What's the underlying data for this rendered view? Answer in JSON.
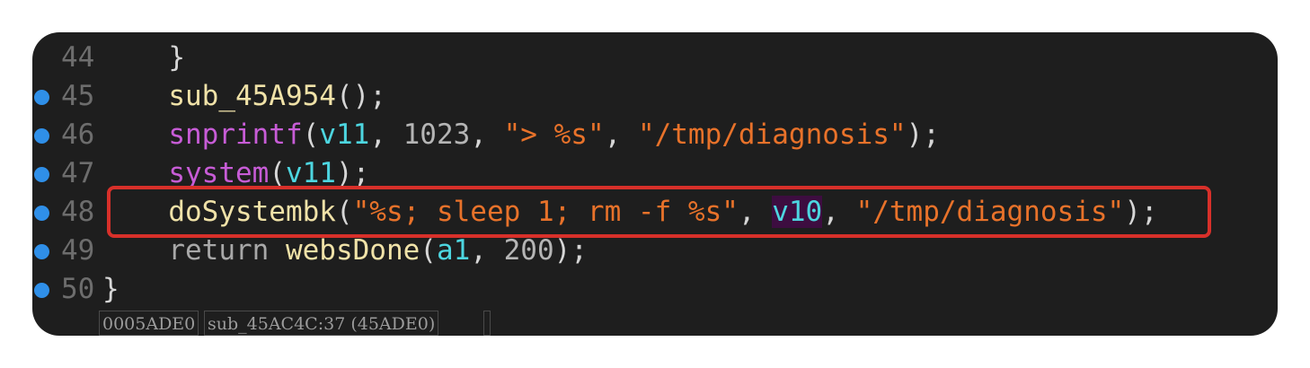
{
  "lines": [
    {
      "num": "44",
      "parts": [
        {
          "t": "  }",
          "c": "plain"
        }
      ],
      "breakpoint": false
    },
    {
      "num": "45",
      "parts": [
        {
          "t": "  ",
          "c": "plain"
        },
        {
          "t": "sub_45A954",
          "c": "fn-yellow"
        },
        {
          "t": "();",
          "c": "plain"
        }
      ],
      "breakpoint": true
    },
    {
      "num": "46",
      "parts": [
        {
          "t": "  ",
          "c": "plain"
        },
        {
          "t": "snprintf",
          "c": "fn-purple"
        },
        {
          "t": "(",
          "c": "plain"
        },
        {
          "t": "v11",
          "c": "var"
        },
        {
          "t": ", ",
          "c": "plain"
        },
        {
          "t": "1023",
          "c": "num"
        },
        {
          "t": ", ",
          "c": "plain"
        },
        {
          "t": "\"> %s\"",
          "c": "str"
        },
        {
          "t": ", ",
          "c": "plain"
        },
        {
          "t": "\"/tmp/diagnosis\"",
          "c": "str"
        },
        {
          "t": ");",
          "c": "plain"
        }
      ],
      "breakpoint": true
    },
    {
      "num": "47",
      "parts": [
        {
          "t": "  ",
          "c": "plain"
        },
        {
          "t": "system",
          "c": "fn-purple"
        },
        {
          "t": "(",
          "c": "plain"
        },
        {
          "t": "v11",
          "c": "var"
        },
        {
          "t": ");",
          "c": "plain"
        }
      ],
      "breakpoint": true
    },
    {
      "num": "48",
      "parts": [
        {
          "t": "  ",
          "c": "plain"
        },
        {
          "t": "doSystembk",
          "c": "fn-yellow"
        },
        {
          "t": "(",
          "c": "plain"
        },
        {
          "t": "\"%s; sleep 1; rm -f %s\"",
          "c": "str"
        },
        {
          "t": ", ",
          "c": "plain"
        },
        {
          "t": "v10",
          "c": "var hl"
        },
        {
          "t": ", ",
          "c": "plain"
        },
        {
          "t": "\"/tmp/diagnosis\"",
          "c": "str"
        },
        {
          "t": ");",
          "c": "plain"
        }
      ],
      "breakpoint": true
    },
    {
      "num": "49",
      "parts": [
        {
          "t": "  ",
          "c": "plain"
        },
        {
          "t": "return",
          "c": "kw"
        },
        {
          "t": " ",
          "c": "plain"
        },
        {
          "t": "websDone",
          "c": "fn-yellow"
        },
        {
          "t": "(",
          "c": "plain"
        },
        {
          "t": "a1",
          "c": "var"
        },
        {
          "t": ", ",
          "c": "plain"
        },
        {
          "t": "200",
          "c": "num"
        },
        {
          "t": ");",
          "c": "plain"
        }
      ],
      "breakpoint": true
    },
    {
      "num": "50",
      "parts": [
        {
          "t": "}",
          "c": "plain"
        }
      ],
      "breakpoint": true
    }
  ],
  "status": {
    "address": "0005ADE0",
    "location": "sub_45AC4C:37 (45ADE0)"
  },
  "colors": {
    "background": "#1e1e1e",
    "breakpoint": "#2f8fe8",
    "highlight_box": "#d8302a"
  }
}
